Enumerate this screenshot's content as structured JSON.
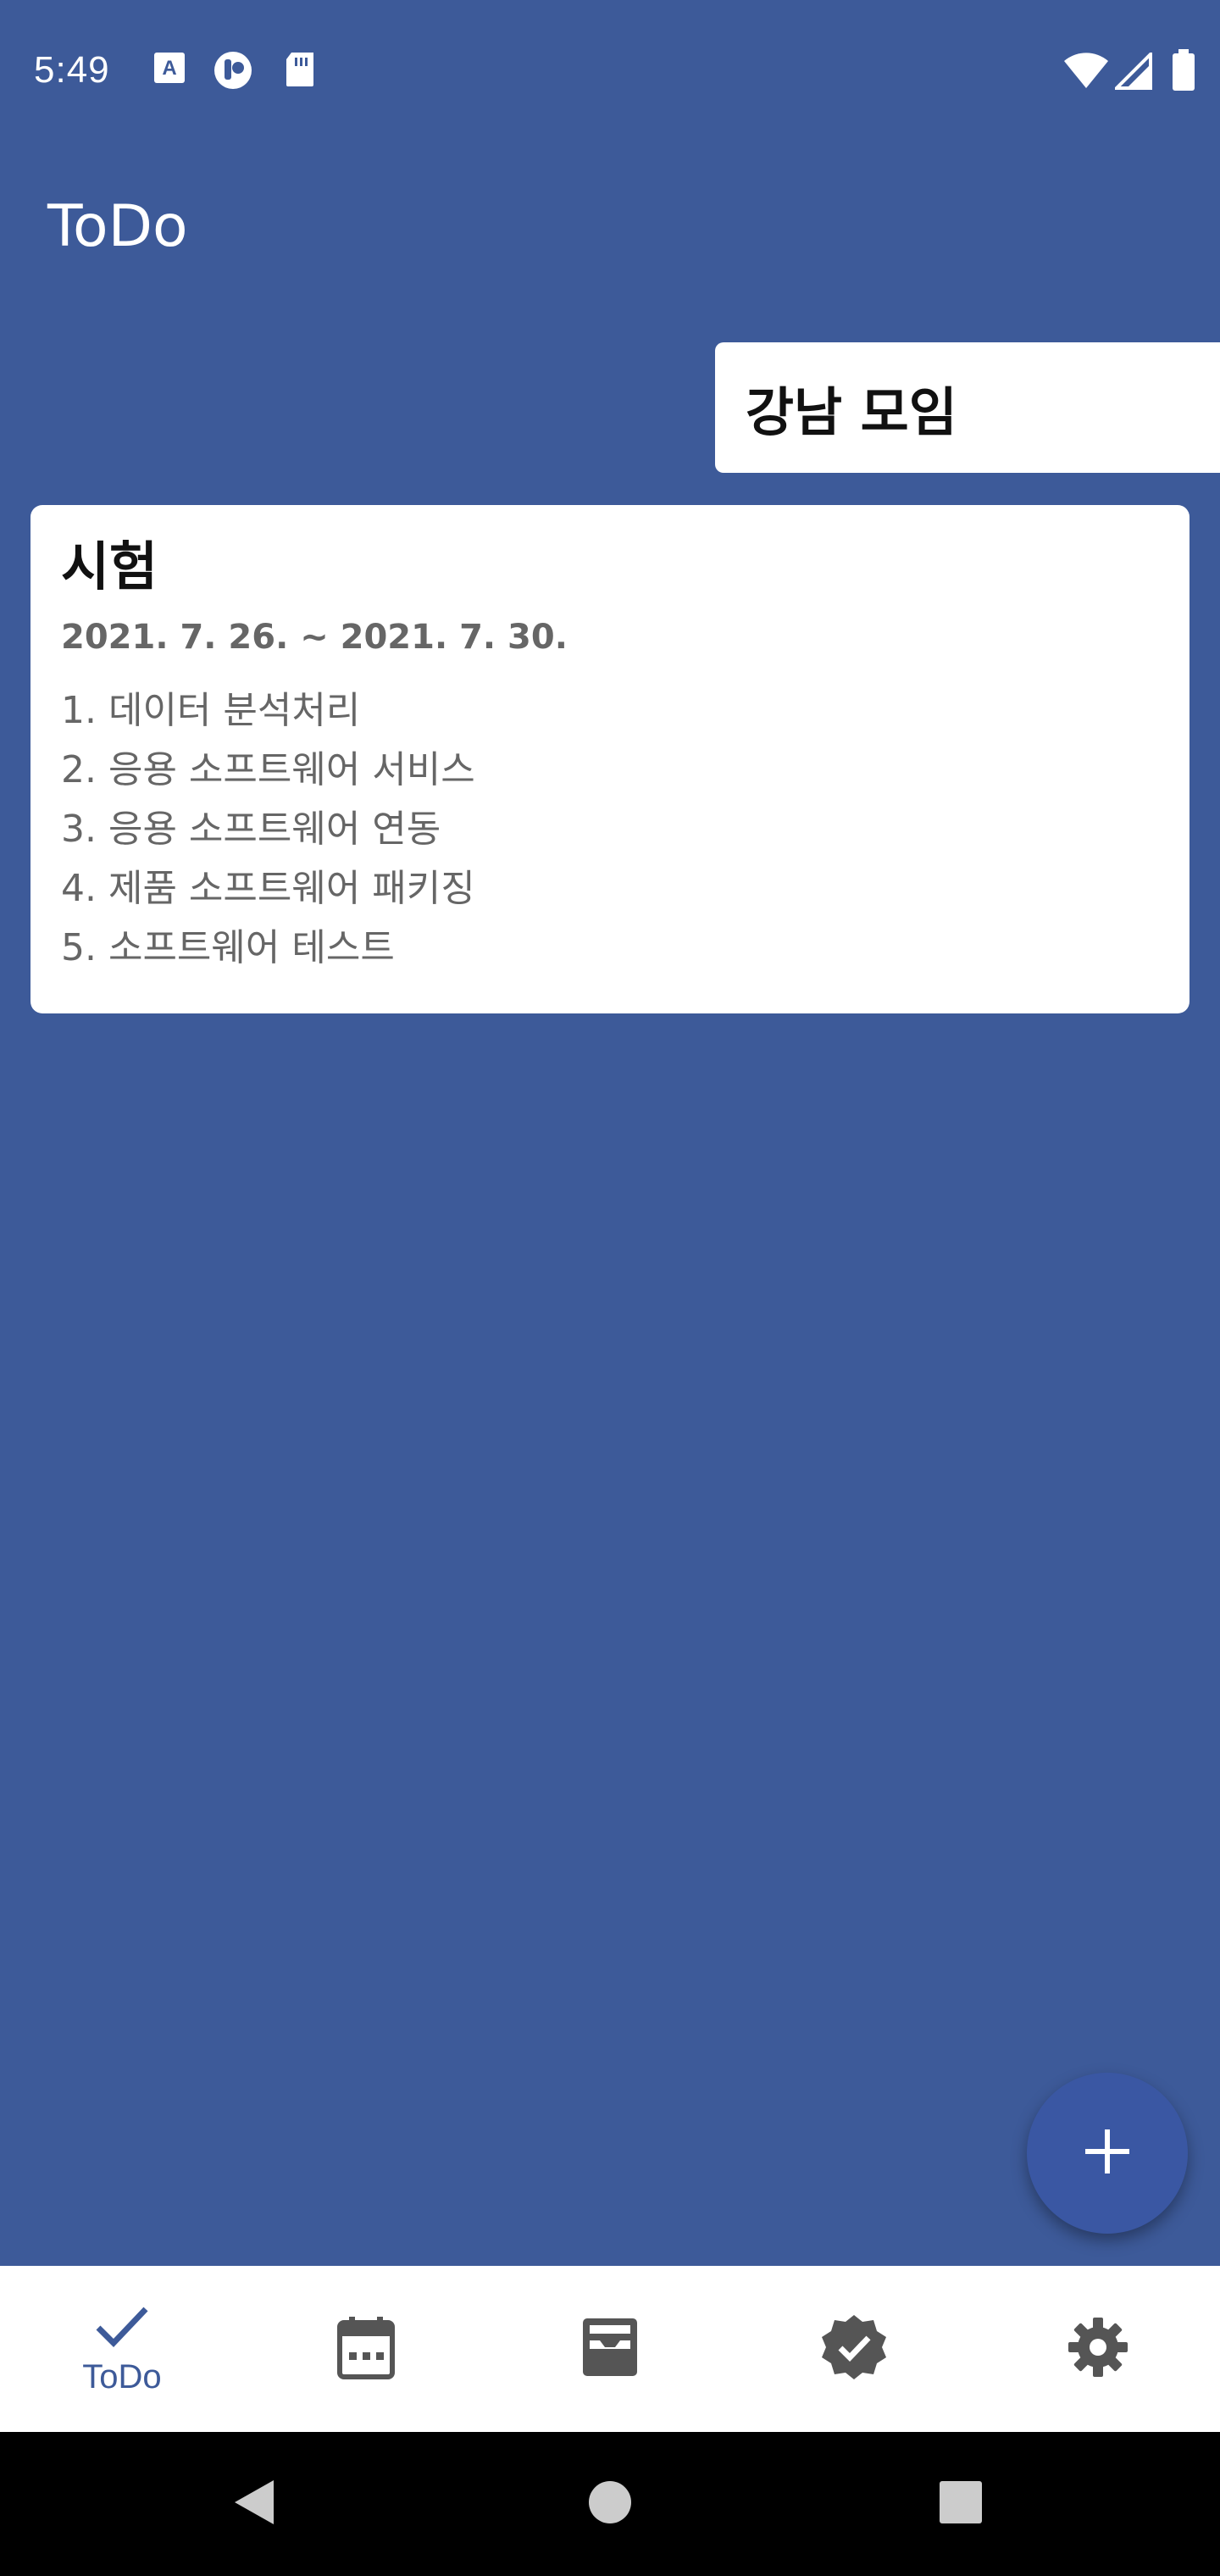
{
  "status_bar": {
    "time": "5:49",
    "left_icons": [
      "font-a-icon",
      "circle-app-icon",
      "sd-card-icon"
    ],
    "right_icons": [
      "wifi-icon",
      "signal-icon",
      "battery-icon"
    ]
  },
  "app_bar": {
    "title": "ToDo"
  },
  "swiped_card": {
    "title": "강남 모임"
  },
  "todo_card": {
    "title": "시험",
    "date_range": "2021. 7. 26. ~ 2021. 7. 30.",
    "items": [
      "1. 데이터 분석처리",
      "2. 응용 소프트웨어 서비스",
      "3. 응용 소프트웨어 연동",
      "4. 제품 소프트웨어 패키징",
      "5. 소프트웨어 테스트"
    ]
  },
  "fab": {
    "icon": "plus-icon"
  },
  "bottom_nav": {
    "items": [
      {
        "icon": "check-icon",
        "label": "ToDo",
        "active": true
      },
      {
        "icon": "calendar-icon",
        "label": "",
        "active": false
      },
      {
        "icon": "inbox-icon",
        "label": "",
        "active": false
      },
      {
        "icon": "verified-badge-icon",
        "label": "",
        "active": false
      },
      {
        "icon": "gear-icon",
        "label": "",
        "active": false
      }
    ]
  },
  "system_nav": {
    "buttons": [
      "back-icon",
      "home-icon",
      "recents-icon"
    ]
  },
  "colors": {
    "background": "#3d5a99",
    "card": "#ffffff",
    "fab": "#3a57a3",
    "nav_active": "#3d5a99",
    "nav_inactive": "#555555"
  }
}
